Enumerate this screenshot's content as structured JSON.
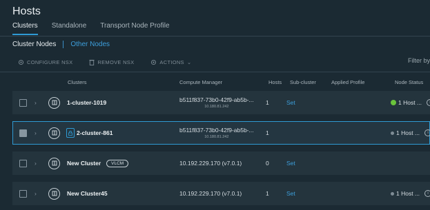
{
  "title": "Hosts",
  "tabs": [
    "Clusters",
    "Standalone",
    "Transport Node Profile"
  ],
  "subtabs": [
    "Cluster Nodes",
    "Other Nodes"
  ],
  "toolbar": {
    "configure": "CONFIGURE NSX",
    "remove": "REMOVE NSX",
    "actions": "ACTIONS"
  },
  "filter": "Filter by",
  "columns": {
    "clusters": "Clusters",
    "compute_manager": "Compute Manager",
    "hosts": "Hosts",
    "sub_cluster": "Sub-cluster",
    "applied_profile": "Applied Profile",
    "node_status": "Node Status"
  },
  "rows": [
    {
      "name": "1-cluster-1019",
      "cm": "b511f837-73b0-42f9-ab5b-...",
      "cm_ip": "10.180.81.242",
      "hosts": "1",
      "set": "Set",
      "status": "1 Host ..."
    },
    {
      "name": "2-cluster-861",
      "cm": "b511f837-73b0-42f9-ab5b-...",
      "cm_ip": "10.180.81.242",
      "hosts": "1",
      "set": "",
      "status": "1 Host ..."
    },
    {
      "name": "New Cluster",
      "badge": "VLCM",
      "cm": "10.192.229.170 (v7.0.1)",
      "cm_ip": "",
      "hosts": "0",
      "set": "Set",
      "status": ""
    },
    {
      "name": "New Cluster45",
      "cm": "10.192.229.170 (v7.0.1)",
      "cm_ip": "",
      "hosts": "1",
      "set": "Set",
      "status": "1 Host ..."
    }
  ],
  "colors": {
    "accent": "#2f9bd4",
    "link": "#3d9fdc",
    "success": "#6ac43c"
  }
}
